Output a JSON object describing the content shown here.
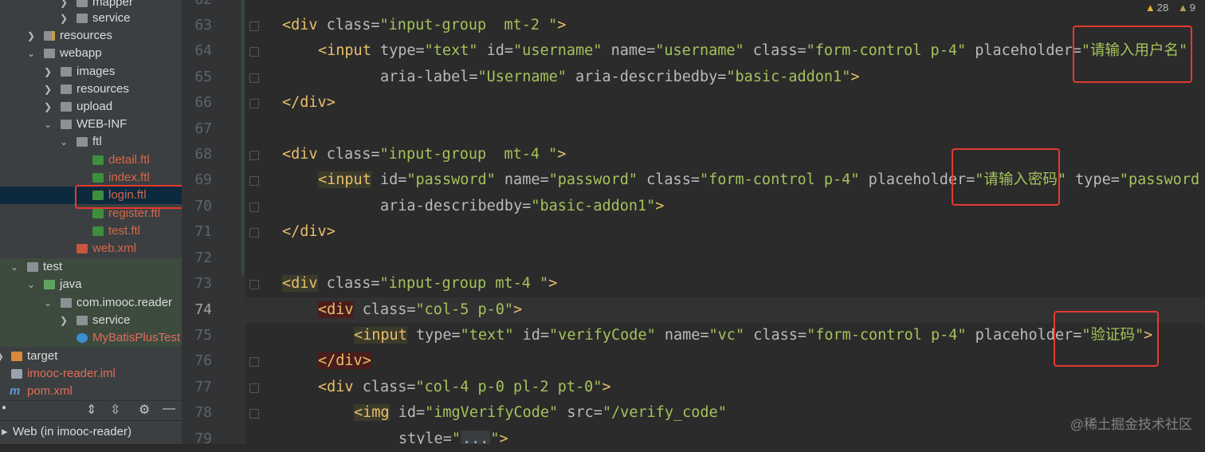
{
  "project_tree": {
    "items": [
      {
        "label": "mapper"
      },
      {
        "label": "service"
      },
      {
        "label": "resources"
      },
      {
        "label": "webapp"
      },
      {
        "label": "images"
      },
      {
        "label": "resources"
      },
      {
        "label": "upload"
      },
      {
        "label": "WEB-INF"
      },
      {
        "label": "ftl"
      },
      {
        "label": "detail.ftl"
      },
      {
        "label": "index.ftl"
      },
      {
        "label": "login.ftl"
      },
      {
        "label": "register.ftl"
      },
      {
        "label": "test.ftl"
      },
      {
        "label": "web.xml"
      },
      {
        "label": "test"
      },
      {
        "label": "java"
      },
      {
        "label": "com.imooc.reader"
      },
      {
        "label": "service"
      },
      {
        "label": "MyBatisPlusTest"
      },
      {
        "label": "target"
      },
      {
        "label": "imooc-reader.iml"
      },
      {
        "label": "pom.xml"
      }
    ],
    "run_config": "Web (in imooc-reader)"
  },
  "inspections": {
    "warnings": "28",
    "weak_warnings": "9"
  },
  "gutter": {
    "line_numbers": [
      "62",
      "63",
      "64",
      "65",
      "66",
      "67",
      "68",
      "69",
      "70",
      "71",
      "72",
      "73",
      "74",
      "75",
      "76",
      "77",
      "78",
      "79"
    ]
  },
  "code": {
    "l63": {
      "t1": "<div",
      "a1": " class=",
      "v1": "\"input-group  mt-2 \"",
      "t2": ">"
    },
    "l64": {
      "t1": "<input",
      "a1": " type=",
      "v1": "\"text\"",
      "a2": " id=",
      "v2": "\"username\"",
      "a3": " name=",
      "v3": "\"username\"",
      "a4": " class=",
      "v4": "\"form-control p-4\"",
      "a5": " placeholder=",
      "v5": "\"请输入用户名\""
    },
    "l65": {
      "a1": "aria-label=",
      "v1": "\"Username\"",
      "a2": " aria-describedby=",
      "v2": "\"basic-addon1\"",
      "t1": ">"
    },
    "l66": {
      "t1": "</div>"
    },
    "l68": {
      "t1": "<div",
      "a1": " class=",
      "v1": "\"input-group  mt-4 \"",
      "t2": ">"
    },
    "l69": {
      "t1": "<input",
      "a1": " id=",
      "v1": "\"password\"",
      "a2": " name=",
      "v2": "\"password\"",
      "a3": " class=",
      "v3": "\"form-control p-4\"",
      "a4": " placeholder=",
      "v4": "\"请输入密码\"",
      "a5": " type=",
      "v5": "\"password"
    },
    "l70": {
      "a1": "aria-describedby=",
      "v1": "\"basic-addon1\"",
      "t1": ">"
    },
    "l71": {
      "t1": "</div>"
    },
    "l73": {
      "t1": "<div",
      "a1": " class=",
      "v1": "\"input-group mt-4 \"",
      "t2": ">"
    },
    "l74": {
      "t1": "<div",
      "a1": " class=",
      "v1": "\"col-5 p-0\"",
      "t2": ">"
    },
    "l75": {
      "t1": "<input",
      "a1": " type=",
      "v1": "\"text\"",
      "a2": " id=",
      "v2": "\"verifyCode\"",
      "a3": " name=",
      "v3": "\"vc\"",
      "a4": " class=",
      "v4": "\"form-control p-4\"",
      "a5": " placeholder=",
      "v5": "\"验证码\"",
      "t2": ">"
    },
    "l76": {
      "t1": "</div>"
    },
    "l77": {
      "t1": "<div",
      "a1": " class=",
      "v1": "\"col-4 p-0 pl-2 pt-0\"",
      "t2": ">"
    },
    "l78": {
      "t1": "<img",
      "a1": " id=",
      "v1": "\"imgVerifyCode\"",
      "a2": " src=",
      "v2": "\"/verify_code\""
    },
    "l79": {
      "a1": "style=",
      "v1": "\"",
      "f1": "...",
      "v2": "\"",
      "t1": ">"
    }
  },
  "watermark": "@稀土掘金技术社区",
  "colors": {
    "highlight_box": "#e43a2f",
    "tag": "#e8bf6a",
    "string": "#a5c25c",
    "attr": "#bababa"
  }
}
